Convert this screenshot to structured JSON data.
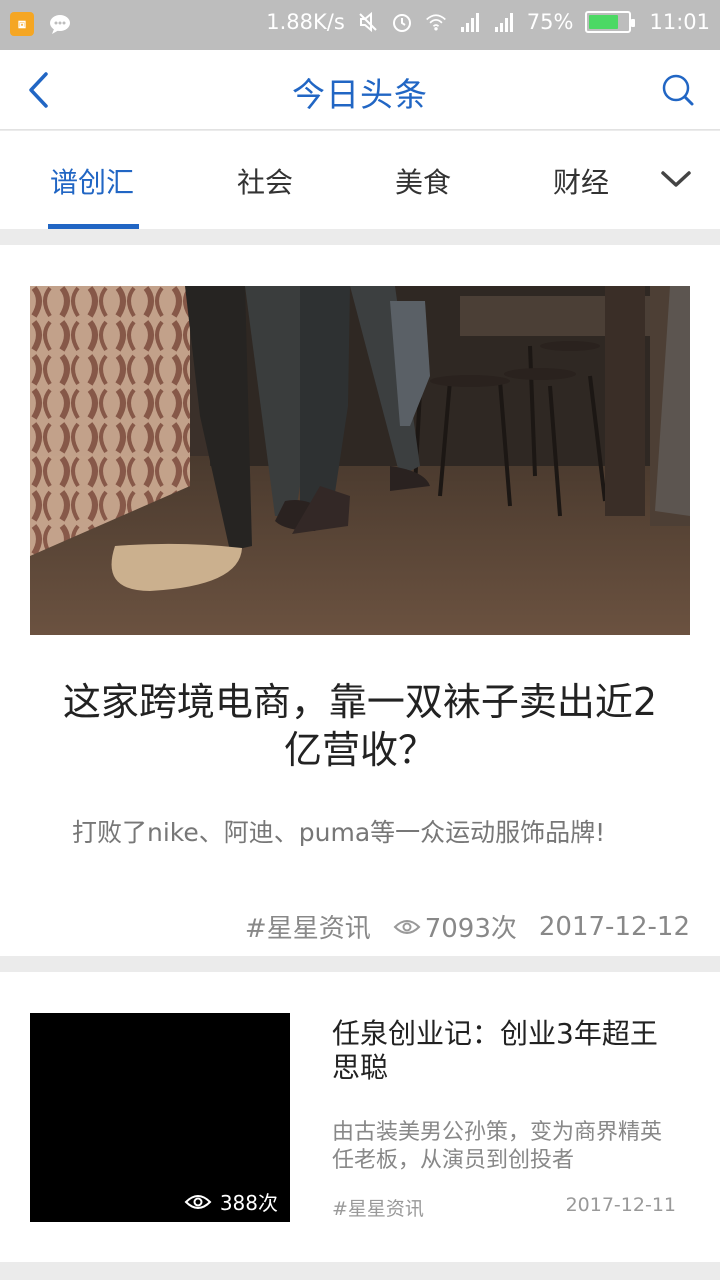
{
  "status_bar": {
    "speed": "1.88K/s",
    "battery": "75%",
    "battery_level": 0.75,
    "time": "11:01",
    "icons": [
      "app-notification-icon",
      "message-icon",
      "mute-icon",
      "alarm-icon",
      "wifi-icon",
      "signal-icon",
      "signal-icon-2",
      "battery-icon"
    ]
  },
  "header": {
    "title": "今日头条",
    "back_icon": "chevron-left-icon",
    "search_icon": "search-icon"
  },
  "tabs": {
    "items": [
      {
        "label": "谱创汇",
        "active": true
      },
      {
        "label": "社会",
        "active": false
      },
      {
        "label": "美食",
        "active": false
      },
      {
        "label": "财经",
        "active": false
      }
    ],
    "more_icon": "chevron-down-icon"
  },
  "articles": [
    {
      "title": "这家跨境电商，靠一双袜子卖出近2亿营收？",
      "summary": "打败了nike、阿迪、puma等一众运动服饰品牌!",
      "source": "#星星资讯",
      "views": "7093次",
      "date": "2017-12-12"
    },
    {
      "title": "任泉创业记：创业3年超王思聪",
      "summary": "由古装美男公孙策，变为商界精英任老板，从演员到创投者",
      "source": "#星星资讯",
      "views": "388次",
      "date": "2017-12-11"
    }
  ],
  "colors": {
    "accent": "#2166c4",
    "status_bar": "#bdbdbd",
    "battery_fill": "#4cd964"
  }
}
